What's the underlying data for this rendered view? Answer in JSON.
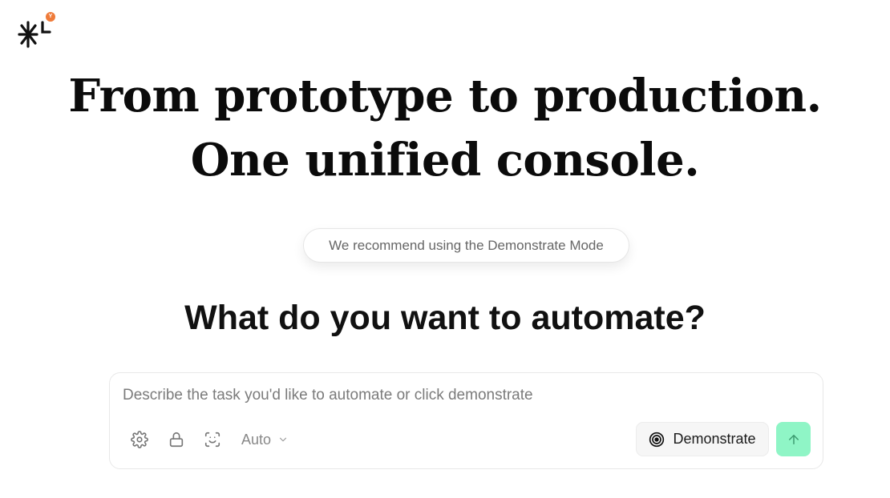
{
  "brand": {
    "logo_icon": "asterisk-burst-logo",
    "badge_text": "Y",
    "badge_color": "#ef7b3a"
  },
  "hero": {
    "line1": "From prototype to production.",
    "line2": "One unified console."
  },
  "recommendation": {
    "text": "We recommend using the Demonstrate Mode"
  },
  "prompt": {
    "question": "What do you want to automate?"
  },
  "composer": {
    "placeholder": "Describe the task you'd like to automate or click demonstrate",
    "value": "",
    "tools": [
      "settings-gear-icon",
      "lock-icon",
      "screen-capture-icon"
    ],
    "model_select": "Auto",
    "demonstrate_label": "Demonstrate",
    "send_icon": "arrow-up-icon",
    "send_color": "#8ff5c6"
  }
}
